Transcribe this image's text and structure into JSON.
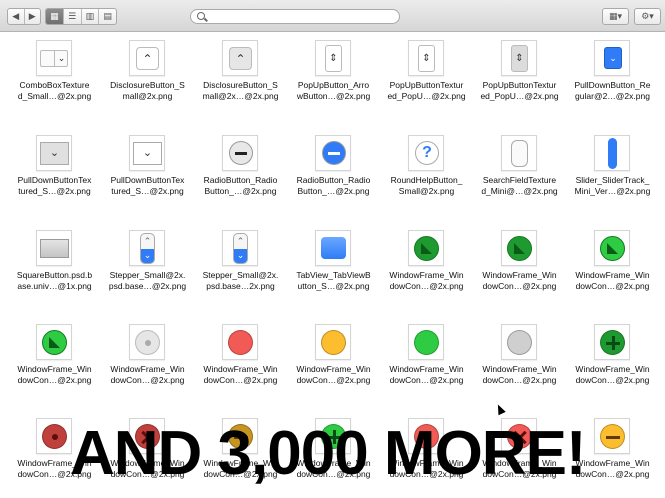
{
  "toolbar": {
    "nav": [
      "◀",
      "▶"
    ],
    "views": [
      "▦",
      "☰",
      "▥",
      "▤"
    ],
    "arrange_icon": "grid-arrange-icon",
    "action_icon": "gear-icon"
  },
  "items": [
    [
      "ComboBoxTexture",
      "d_Small…@2x.png"
    ],
    [
      "DisclosureButton_S",
      "mall@2x.png"
    ],
    [
      "DisclosureButton_S",
      "mall@2x…@2x.png"
    ],
    [
      "PopUpButton_Arro",
      "wButton…@2x.png"
    ],
    [
      "PopUpButtonTextur",
      "ed_PopU…@2x.png"
    ],
    [
      "PopUpButtonTextur",
      "ed_PopU…@2x.png"
    ],
    [
      "PullDownButton_Re",
      "gular@2…@2x.png"
    ],
    [
      "PullDownButtonTex",
      "tured_S…@2x.png"
    ],
    [
      "PullDownButtonTex",
      "tured_S…@2x.png"
    ],
    [
      "RadioButton_Radio",
      "Button_…@2x.png"
    ],
    [
      "RadioButton_Radio",
      "Button_…@2x.png"
    ],
    [
      "RoundHelpButton_",
      "Small@2x.png"
    ],
    [
      "SearchFieldTexture",
      "d_Mini@…@2x.png"
    ],
    [
      "Slider_SliderTrack_",
      "Mini_Ver…@2x.png"
    ],
    [
      "SquareButton.psd.b",
      "ase.univ…@1x.png"
    ],
    [
      "Stepper_Small@2x.",
      "psd.base…@2x.png"
    ],
    [
      "Stepper_Small@2x.",
      "psd.base…2x.png"
    ],
    [
      "TabView_TabViewB",
      "utton_S…@2x.png"
    ],
    [
      "WindowFrame_Win",
      "dowCon…@2x.png"
    ],
    [
      "WindowFrame_Win",
      "dowCon…@2x.png"
    ],
    [
      "WindowFrame_Win",
      "dowCon…@2x.png"
    ],
    [
      "WindowFrame_Win",
      "dowCon…@2x.png"
    ],
    [
      "WindowFrame_Win",
      "dowCon…@2x.png"
    ],
    [
      "WindowFrame_Win",
      "dowCon…@2x.png"
    ],
    [
      "WindowFrame_Win",
      "dowCon…@2x.png"
    ],
    [
      "WindowFrame_Win",
      "dowCon…@2x.png"
    ],
    [
      "WindowFrame_Win",
      "dowCon…@2x.png"
    ],
    [
      "WindowFrame_Win",
      "dowCon…@2x.png"
    ],
    [
      "WindowFrame_Win",
      "dowCon…@2x.png"
    ],
    [
      "WindowFrame_Win",
      "dowCon…@2x.png"
    ],
    [
      "WindowFrame_Win",
      "dowCon…@2x.png"
    ],
    [
      "WindowFrame_Win",
      "dowCon…@2x.png"
    ],
    [
      "WindowFrame_Win",
      "dowCon…@2x.png"
    ],
    [
      "WindowFrame_Win",
      "dowCon…@2x.png"
    ],
    [
      "WindowFrame_Win",
      "dowCon…@2x.png"
    ]
  ],
  "headline": "AND 3,000 MORE!",
  "colors": {
    "red": "#f25a55",
    "yellow": "#fcbd2f",
    "green": "#2ecc43",
    "gray": "#cfcfcf",
    "dark_red": "#c0403b",
    "dark_yellow": "#c69420",
    "dark_green": "#1f9a30",
    "blue": "#2f7cf6"
  }
}
